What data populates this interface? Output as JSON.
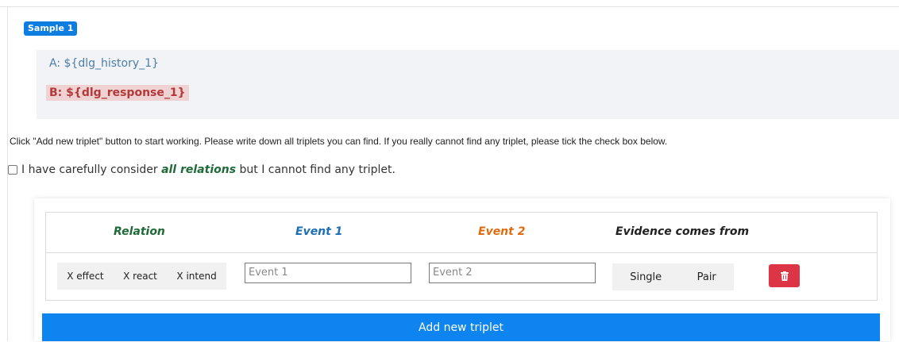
{
  "sample": {
    "badge": "Sample 1"
  },
  "dialog": {
    "line_a": "A: ${dlg_history_1}",
    "line_b": "B: ${dlg_response_1}"
  },
  "instructions": "Click \"Add new triplet\" button to start working. Please write down all triplets you can find. If you really cannot find any triplet, please tick the check box below.",
  "none_checkbox": {
    "checked": false,
    "text_before": "I have carefully consider ",
    "emphasis": "all relations",
    "text_after": " but I cannot find any triplet."
  },
  "table": {
    "headers": {
      "relation": "Relation",
      "event1": "Event 1",
      "event2": "Event 2",
      "evidence": "Evidence comes from"
    },
    "row": {
      "relations": [
        "X effect",
        "X react",
        "X intend"
      ],
      "event1_placeholder": "Event 1",
      "event2_placeholder": "Event 2",
      "evidence_options": [
        "Single",
        "Pair"
      ],
      "delete_icon": "trash-icon"
    }
  },
  "add_button": {
    "label": "Add new triplet"
  },
  "colors": {
    "badge": "#0d7de0",
    "relation_header": "#1f6b38",
    "event1_header": "#1c6fb6",
    "event2_header": "#e06c10",
    "delete_button": "#dc3545",
    "add_button": "#0d84f0",
    "response_highlight": "#f1d2d2"
  }
}
